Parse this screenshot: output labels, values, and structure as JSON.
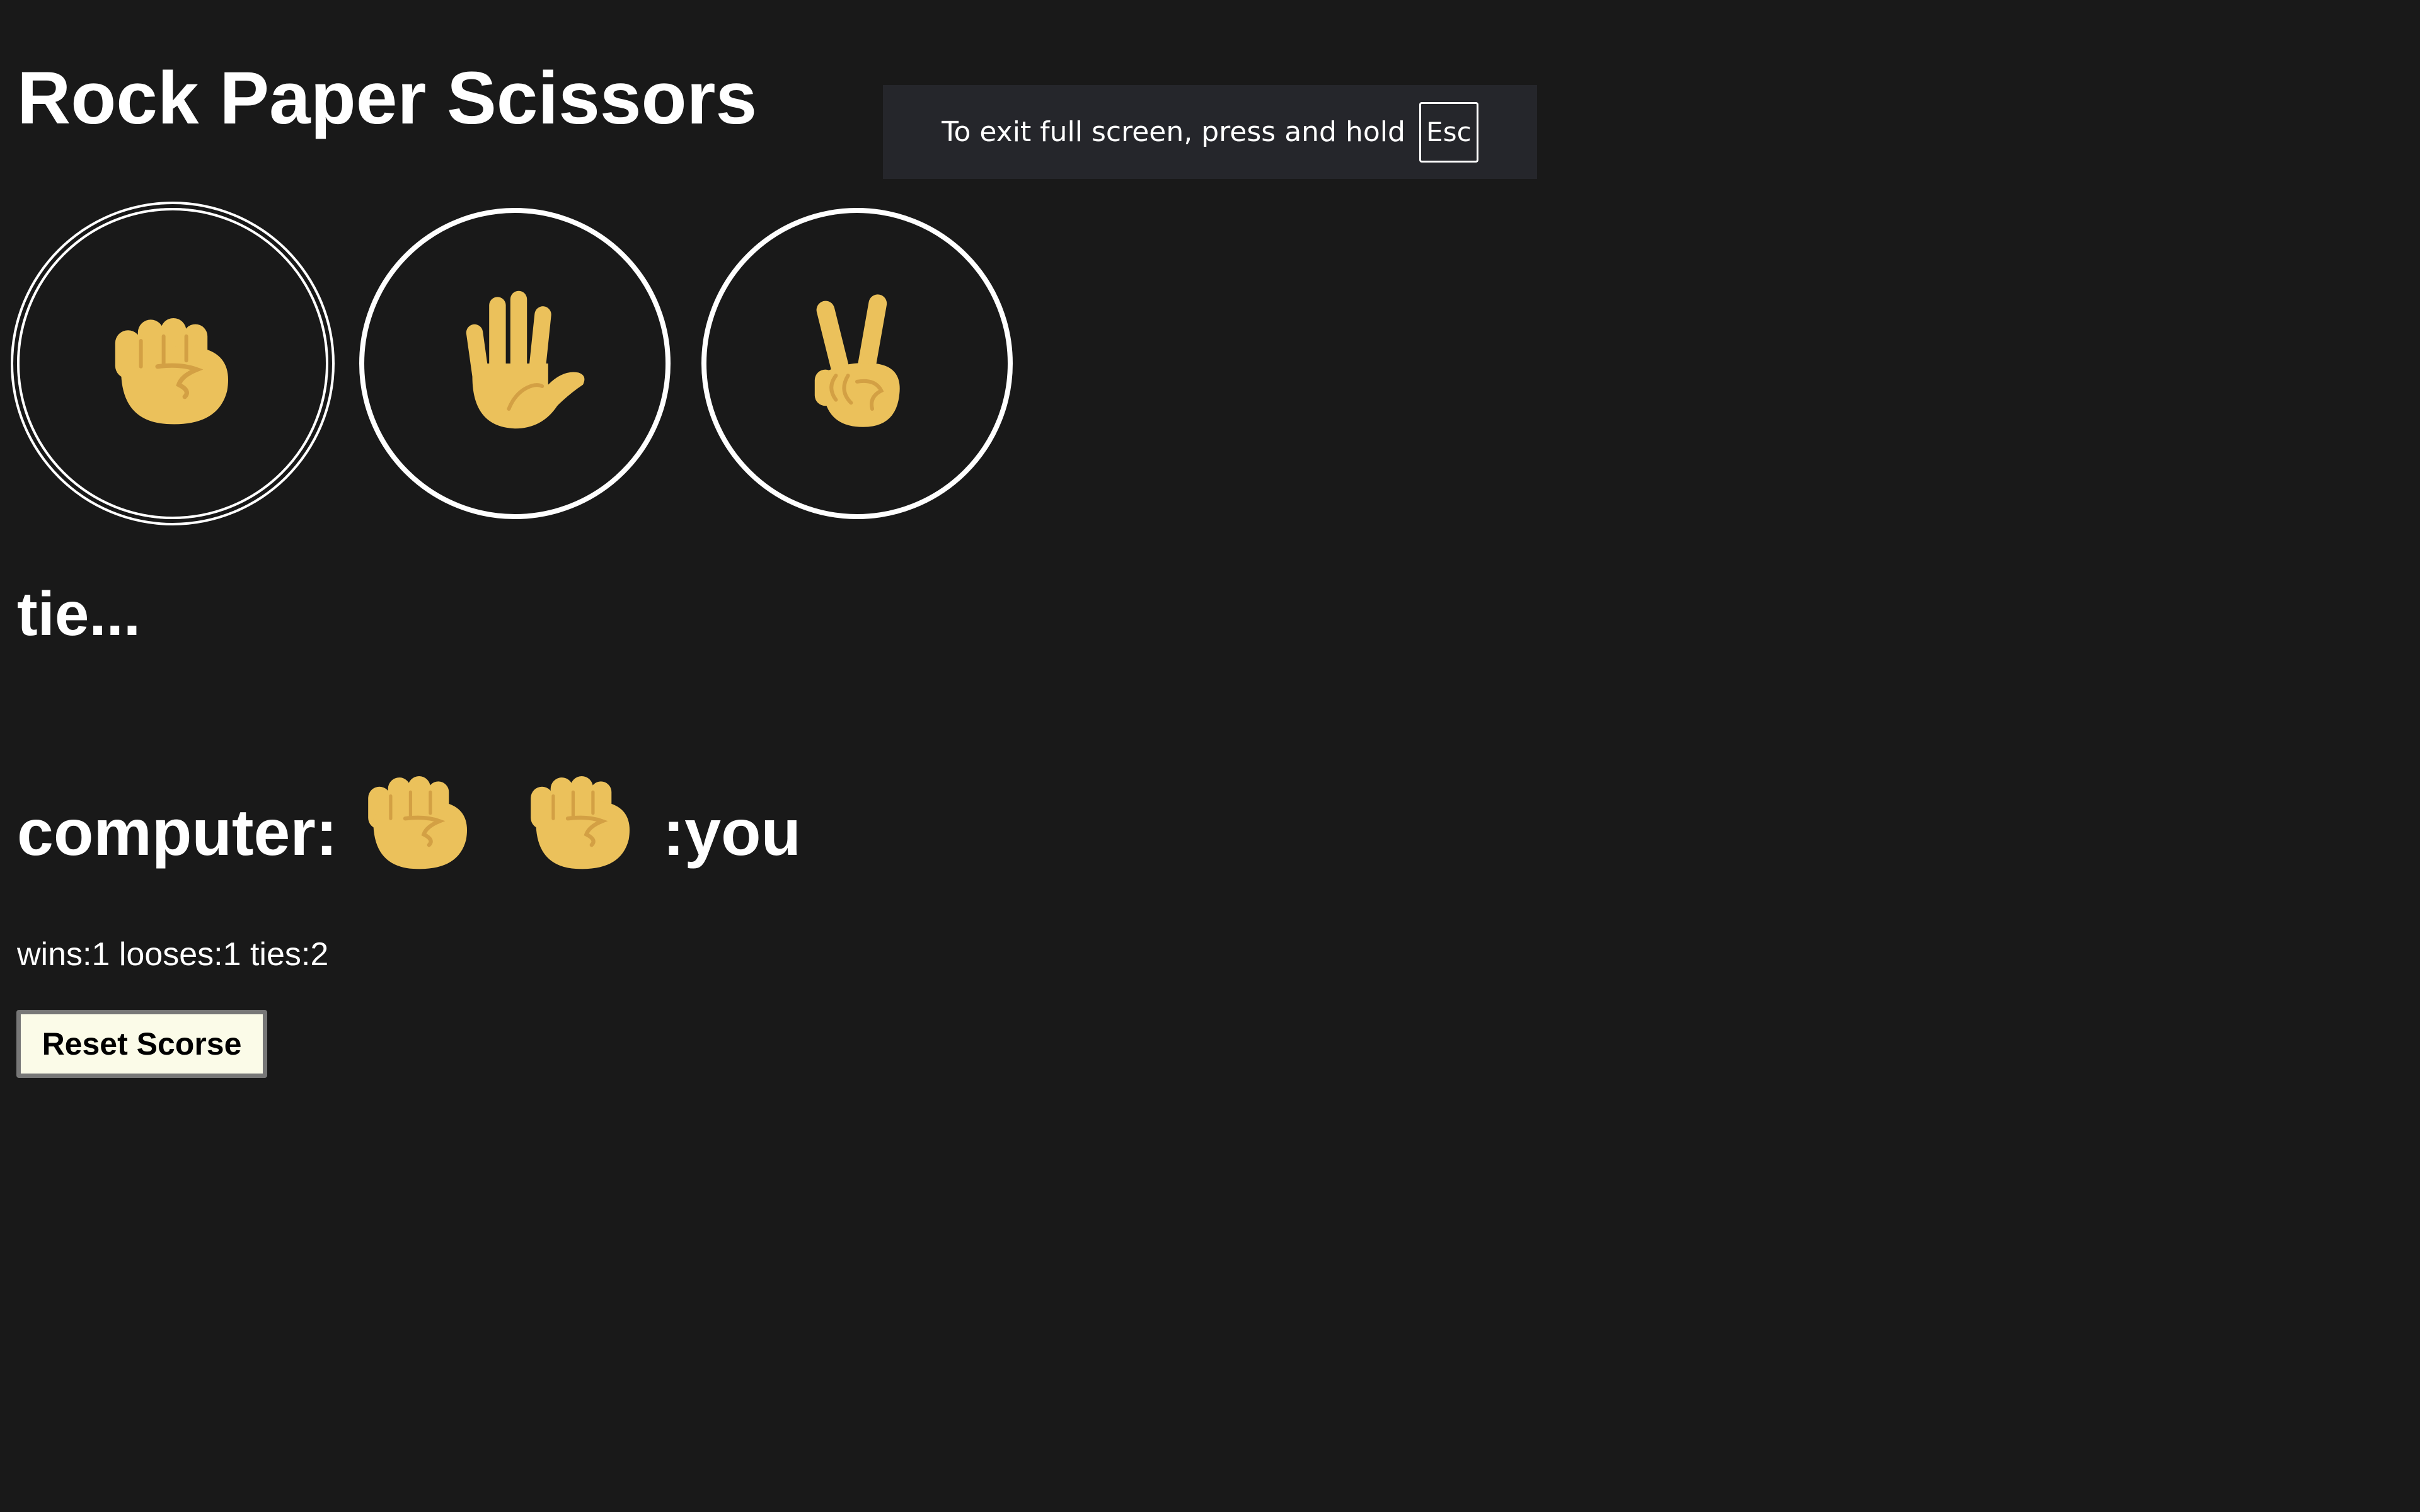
{
  "app": {
    "title": "Rock Paper Scissors"
  },
  "fullscreen_notice": {
    "text": "To exit full screen, press and hold",
    "key": "Esc"
  },
  "choices": [
    {
      "name": "rock",
      "icon": "raised-fist-icon",
      "selected": true
    },
    {
      "name": "paper",
      "icon": "raised-hand-icon",
      "selected": false
    },
    {
      "name": "scissors",
      "icon": "victory-hand-icon",
      "selected": false
    }
  ],
  "result": {
    "text": "tie..."
  },
  "matchup": {
    "computer_label": "computer:",
    "you_label": ":you",
    "computer_move": "rock",
    "you_move": "rock"
  },
  "stats": {
    "text": "wins:1 looses:1 ties:2"
  },
  "reset_button": {
    "label": "Reset Scorse"
  },
  "colors": {
    "background": "#191919",
    "text": "#ffffff",
    "emoji_skin": "#EBC15B",
    "emoji_line": "#D3A044",
    "button_bg": "#FBFBE8"
  }
}
